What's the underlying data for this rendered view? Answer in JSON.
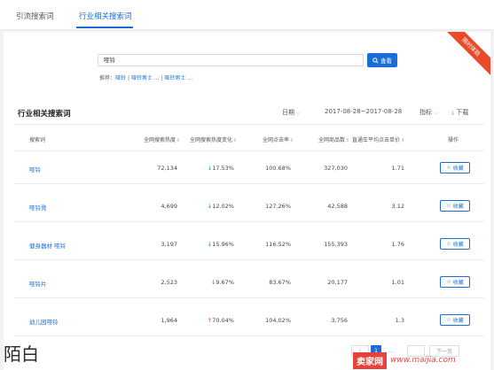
{
  "tabs": [
    {
      "label": "引流搜索词"
    },
    {
      "label": "行业相关搜索词"
    }
  ],
  "ribbon": {
    "label": "限时体验"
  },
  "search": {
    "value": "哑铃",
    "button_label": "查看"
  },
  "recommend": {
    "prefix": "推荐：",
    "items": [
      "哑铃",
      "哑铃男士 ...",
      "哑铃男士 ..."
    ]
  },
  "section": {
    "title": "行业相关搜索词",
    "date_label": "日期",
    "date_range": "2017-08-28~2017-08-28",
    "metric_label": "指标",
    "download_label": "下载"
  },
  "table": {
    "headers": {
      "keyword": "搜索词",
      "popularity": "全网搜索热度",
      "popularity_change": "全网搜索热度变化",
      "ctr": "全网点击率",
      "goods": "全网商品数",
      "cpc": "直通车平均点击单价",
      "action": "操作"
    },
    "rows": [
      {
        "keyword": "哑铃",
        "popularity": "72,134",
        "change": "17.53%",
        "dir": "down",
        "ctr": "100.68%",
        "goods": "327,030",
        "cpc": "1.71",
        "action": "收藏"
      },
      {
        "keyword": "哑铃凳",
        "popularity": "4,699",
        "change": "12.02%",
        "dir": "down",
        "ctr": "127.26%",
        "goods": "42,588",
        "cpc": "3.12",
        "action": "收藏"
      },
      {
        "keyword": "健身器材 哑铃",
        "popularity": "3,197",
        "change": "15.96%",
        "dir": "down",
        "ctr": "116.52%",
        "goods": "155,393",
        "cpc": "1.76",
        "action": "收藏"
      },
      {
        "keyword": "哑铃片",
        "popularity": "2,523",
        "change": "9.67%",
        "dir": "down",
        "ctr": "83.67%",
        "goods": "20,177",
        "cpc": "1.01",
        "action": "收藏"
      },
      {
        "keyword": "幼儿园哑铃",
        "popularity": "1,964",
        "change": "70.04%",
        "dir": "up",
        "ctr": "104.02%",
        "goods": "3,756",
        "cpc": "1.3",
        "action": "收藏"
      }
    ]
  },
  "pagination": {
    "current": "1",
    "next_label": "下一页"
  },
  "watermarks": {
    "left": "陌白",
    "right_cn": "卖家网",
    "right_url": "www.maijia.com"
  },
  "colors": {
    "accent": "#1a6cd8",
    "down": "#2aa14a",
    "up": "#e8433a",
    "ribbon": "#e84a2a"
  }
}
